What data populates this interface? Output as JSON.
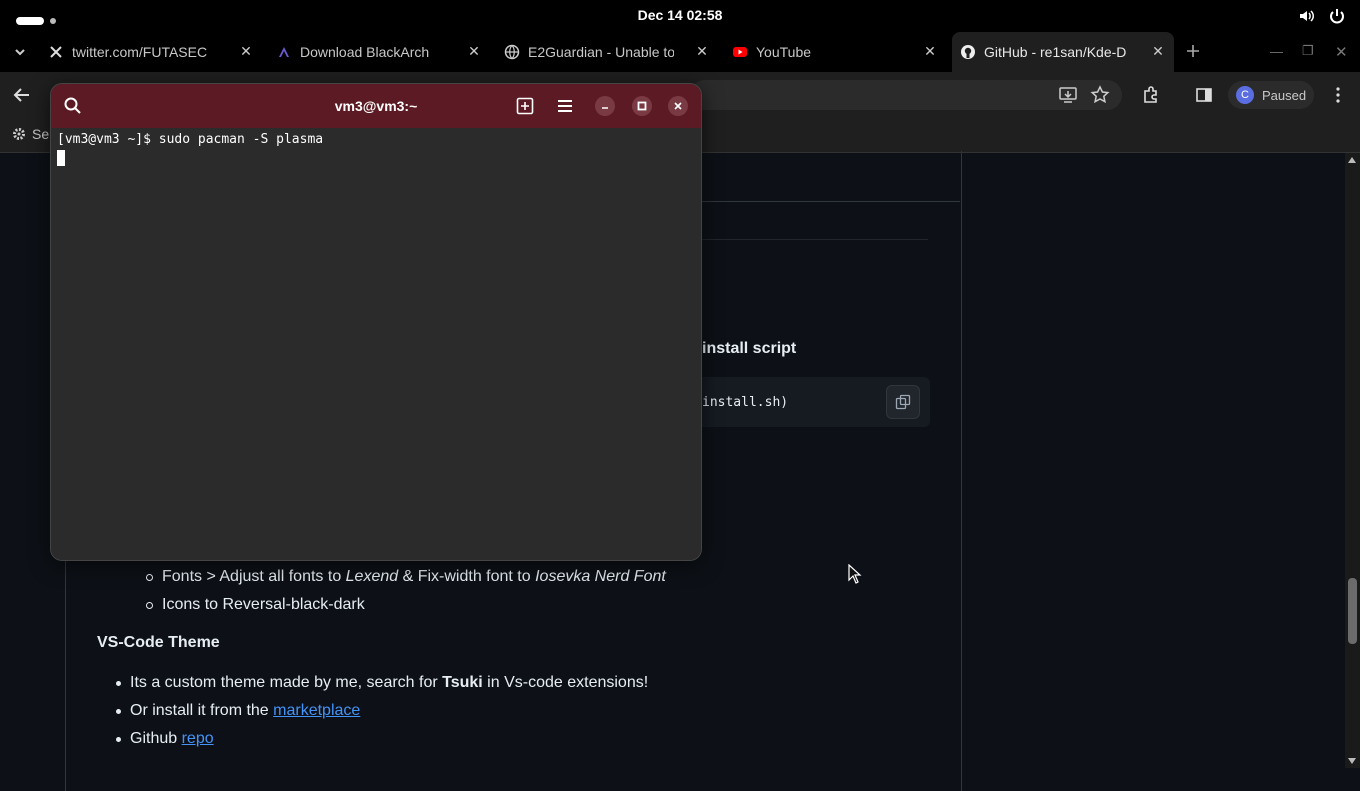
{
  "topbar": {
    "clock": "Dec 14  02:58"
  },
  "tabs": [
    {
      "title": "twitter.com/FUTASEC",
      "favicon": "x-logo-icon"
    },
    {
      "title": "Download BlackArch",
      "favicon": "blackarch-icon"
    },
    {
      "title": "E2Guardian - Unable to",
      "favicon": "globe-icon"
    },
    {
      "title": "YouTube",
      "favicon": "youtube-icon"
    },
    {
      "title": "GitHub - re1san/Kde-D",
      "favicon": "github-icon"
    }
  ],
  "toolbar": {
    "profile_label": "Paused",
    "avatar_letter": "C"
  },
  "bookmarks": {
    "first_label": "Se"
  },
  "terminal": {
    "title": "vm3@vm3:~",
    "command_line": "[vm3@vm3 ~]$ sudo pacman -S plasma"
  },
  "page": {
    "install_heading": "install script",
    "code_text": "install.sh)",
    "fonts_item": {
      "prefix": "Fonts > Adjust all fonts to ",
      "font1": "Lexend",
      "middle": " & Fix-width font to ",
      "font2": "Iosevka Nerd Font"
    },
    "icons_item": "Icons to Reversal-black-dark",
    "vscode_title": "VS-Code Theme",
    "vscode_item1": {
      "prefix": "Its a custom theme made by me, search for ",
      "bold": "Tsuki",
      "suffix": " in Vs-code extensions!"
    },
    "vscode_item2": {
      "prefix": "Or install it from the ",
      "link": "marketplace"
    },
    "vscode_item3": {
      "prefix": "Github ",
      "link": "repo"
    }
  },
  "colors": {
    "terminal_header": "#5c1b24",
    "link": "#4493f8",
    "page_bg": "#0d1117"
  }
}
